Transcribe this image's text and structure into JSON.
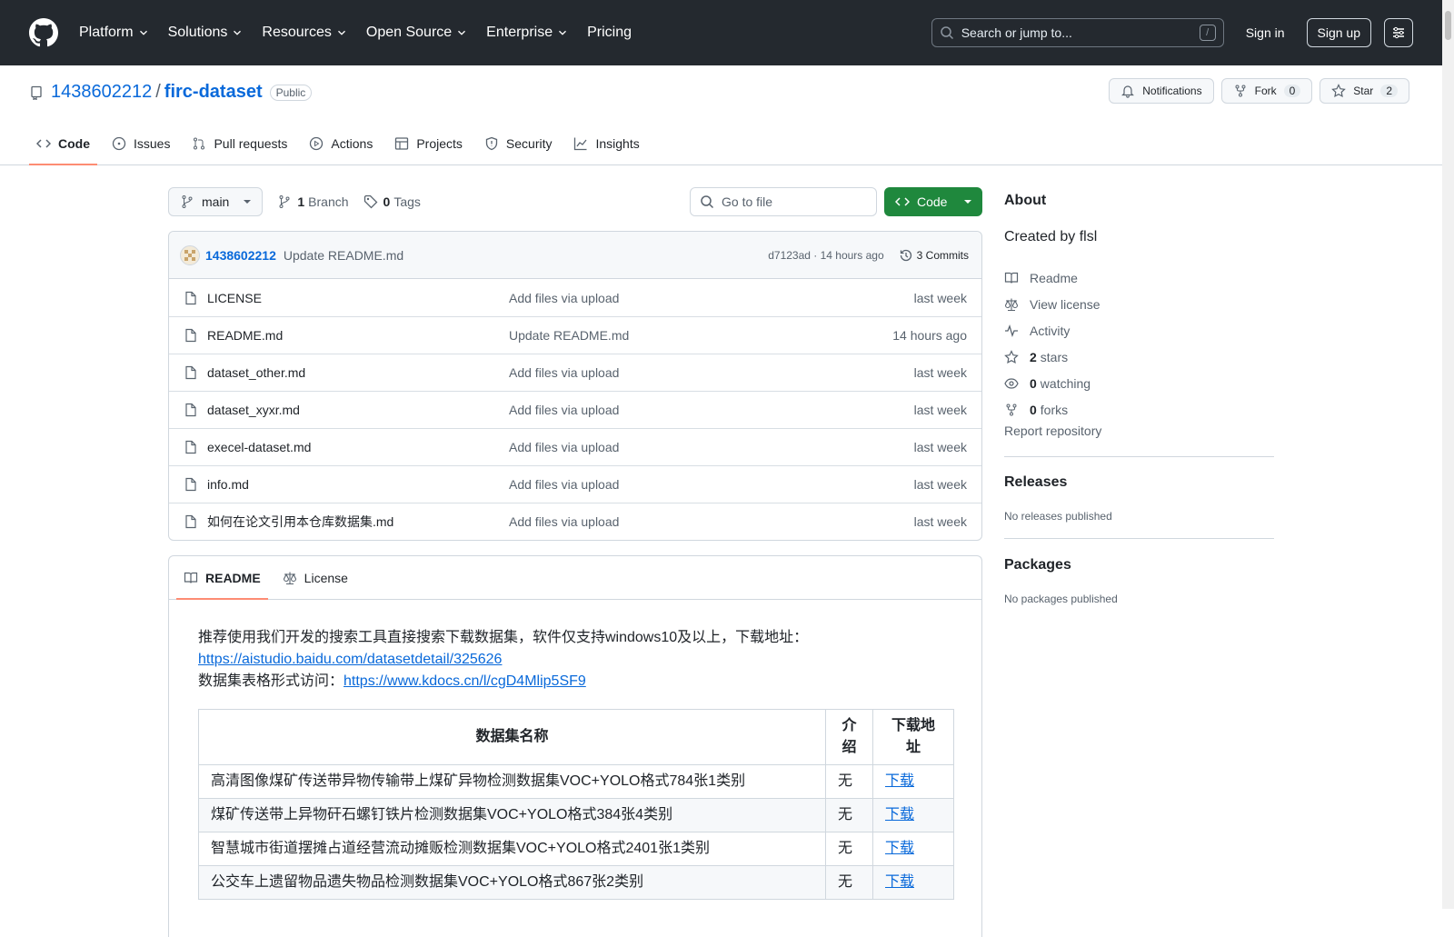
{
  "header": {
    "nav": [
      "Platform",
      "Solutions",
      "Resources",
      "Open Source",
      "Enterprise",
      "Pricing"
    ],
    "search_placeholder": "Search or jump to...",
    "search_shortcut": "/",
    "sign_in": "Sign in",
    "sign_up": "Sign up"
  },
  "repo": {
    "owner": "1438602212",
    "separator": "/",
    "name": "firc-dataset",
    "visibility": "Public",
    "notifications_label": "Notifications",
    "fork_label": "Fork",
    "fork_count": "0",
    "star_label": "Star",
    "star_count": "2",
    "tabs": [
      "Code",
      "Issues",
      "Pull requests",
      "Actions",
      "Projects",
      "Security",
      "Insights"
    ]
  },
  "filebar": {
    "branch": "main",
    "branch_count": "1",
    "branch_label": "Branch",
    "tag_count": "0",
    "tag_label": "Tags",
    "goto_placeholder": "Go to file",
    "code_button": "Code"
  },
  "latest_commit": {
    "author": "1438602212",
    "message": "Update README.md",
    "meta": "d7123ad · 14 hours ago",
    "commits_label": "3 Commits"
  },
  "files": [
    {
      "name": "LICENSE",
      "message": "Add files via upload",
      "date": "last week"
    },
    {
      "name": "README.md",
      "message": "Update README.md",
      "date": "14 hours ago"
    },
    {
      "name": "dataset_other.md",
      "message": "Add files via upload",
      "date": "last week"
    },
    {
      "name": "dataset_xyxr.md",
      "message": "Add files via upload",
      "date": "last week"
    },
    {
      "name": "execel-dataset.md",
      "message": "Add files via upload",
      "date": "last week"
    },
    {
      "name": "info.md",
      "message": "Add files via upload",
      "date": "last week"
    },
    {
      "name": "如何在论文引用本仓库数据集.md",
      "message": "Add files via upload",
      "date": "last week"
    }
  ],
  "readme": {
    "tab_readme": "README",
    "tab_license": "License",
    "intro": "推荐使用我们开发的搜索工具直接搜索下载数据集，软件仅支持windows10及以上，下载地址：",
    "intro_link": "https://aistudio.baidu.com/datasetdetail/325626",
    "table_prefix": "数据集表格形式访问：",
    "table_link": "https://www.kdocs.cn/l/cgD4Mlip5SF9",
    "table_headers": [
      "数据集名称",
      "介绍",
      "下载地址"
    ],
    "rows": [
      {
        "name": "高清图像煤矿传送带异物传输带上煤矿异物检测数据集VOC+YOLO格式784张1类别",
        "intro": "无",
        "link": "下载"
      },
      {
        "name": "煤矿传送带上异物矸石螺钉铁片检测数据集VOC+YOLO格式384张4类别",
        "intro": "无",
        "link": "下载"
      },
      {
        "name": "智慧城市街道摆摊占道经营流动摊贩检测数据集VOC+YOLO格式2401张1类别",
        "intro": "无",
        "link": "下载"
      },
      {
        "name": "公交车上遗留物品遗失物品检测数据集VOC+YOLO格式867张2类别",
        "intro": "无",
        "link": "下载"
      }
    ]
  },
  "sidebar": {
    "about_title": "About",
    "description": "Created by flsl",
    "items": [
      {
        "icon": "book-icon",
        "text": "Readme",
        "bold": ""
      },
      {
        "icon": "scale-icon",
        "text": "View license",
        "bold": ""
      },
      {
        "icon": "pulse-icon",
        "text": "Activity",
        "bold": ""
      },
      {
        "icon": "star-icon",
        "text": "stars",
        "bold": "2"
      },
      {
        "icon": "eye-icon",
        "text": "watching",
        "bold": "0"
      },
      {
        "icon": "fork-icon",
        "text": "forks",
        "bold": "0"
      }
    ],
    "report": "Report repository",
    "releases_title": "Releases",
    "releases_none": "No releases published",
    "packages_title": "Packages",
    "packages_none": "No packages published"
  },
  "colors": {
    "header_bg": "#24292f",
    "link": "#0969da",
    "code_button": "#1f883d",
    "tab_underline": "#fd8c73"
  }
}
